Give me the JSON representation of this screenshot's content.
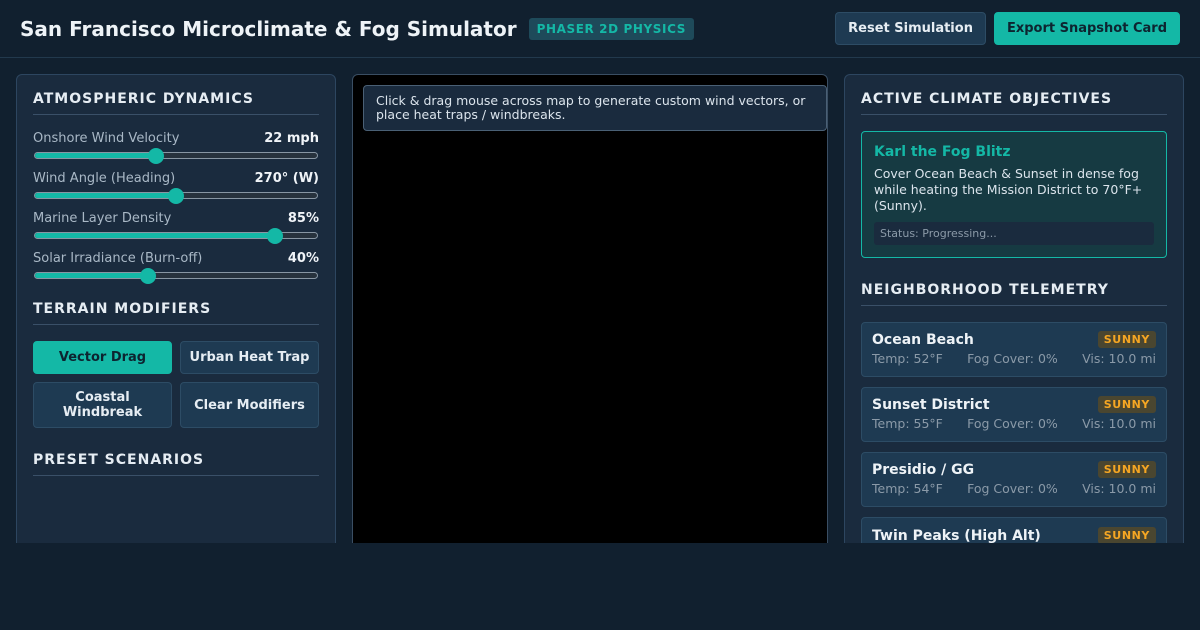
{
  "header": {
    "title": "San Francisco Microclimate & Fog Simulator",
    "badge": "PHASER 2D PHYSICS",
    "reset_label": "Reset Simulation",
    "export_label": "Export Snapshot Card"
  },
  "atmospheric": {
    "title": "ATMOSPHERIC DYNAMICS",
    "sliders": [
      {
        "label": "Onshore Wind Velocity",
        "value": "22 mph",
        "fraction": 0.43
      },
      {
        "label": "Wind Angle (Heading)",
        "value": "270° (W)",
        "fraction": 0.5
      },
      {
        "label": "Marine Layer Density",
        "value": "85%",
        "fraction": 0.85
      },
      {
        "label": "Solar Irradiance (Burn-off)",
        "value": "40%",
        "fraction": 0.4
      }
    ]
  },
  "terrain": {
    "title": "TERRAIN MODIFIERS",
    "buttons": [
      {
        "label": "Vector Drag",
        "active": true
      },
      {
        "label": "Urban Heat Trap",
        "active": false
      },
      {
        "label": "Coastal Windbreak",
        "active": false
      },
      {
        "label": "Clear Modifiers",
        "active": false
      }
    ]
  },
  "presets": {
    "title": "PRESET SCENARIOS"
  },
  "map": {
    "hint": "Click & drag mouse across map to generate custom wind vectors, or place heat traps / windbreaks."
  },
  "objectives": {
    "title": "ACTIVE CLIMATE OBJECTIVES",
    "card": {
      "title": "Karl the Fog Blitz",
      "description": "Cover Ocean Beach & Sunset in dense fog while heating the Mission District to 70°F+ (Sunny).",
      "status": "Status: Progressing..."
    }
  },
  "telemetry": {
    "title": "NEIGHBORHOOD TELEMETRY",
    "neighborhoods": [
      {
        "name": "Ocean Beach",
        "badge": "SUNNY",
        "temp": "Temp: 52°F",
        "fog": "Fog Cover: 0%",
        "vis": "Vis: 10.0 mi"
      },
      {
        "name": "Sunset District",
        "badge": "SUNNY",
        "temp": "Temp: 55°F",
        "fog": "Fog Cover: 0%",
        "vis": "Vis: 10.0 mi"
      },
      {
        "name": "Presidio / GG",
        "badge": "SUNNY",
        "temp": "Temp: 54°F",
        "fog": "Fog Cover: 0%",
        "vis": "Vis: 10.0 mi"
      },
      {
        "name": "Twin Peaks (High Alt)",
        "badge": "SUNNY",
        "temp": "",
        "fog": "",
        "vis": ""
      }
    ]
  },
  "colors": {
    "accent": "#14b8a6",
    "background": "#11202f",
    "panel": "#1a2b3e",
    "sunny": "#f5a623"
  }
}
